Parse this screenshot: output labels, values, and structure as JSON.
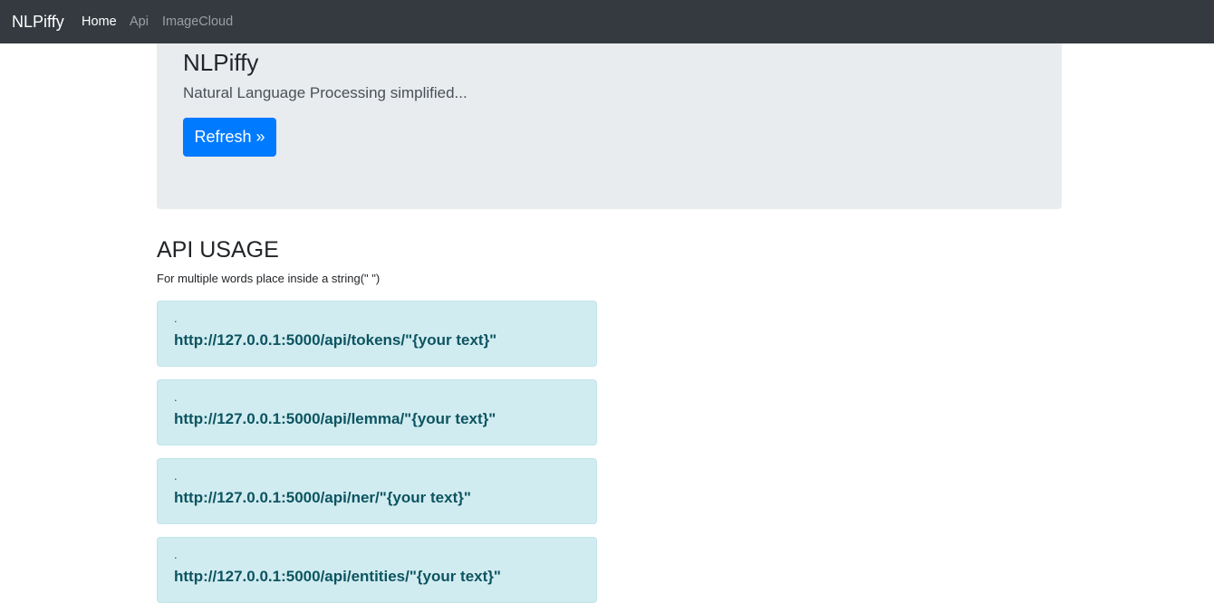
{
  "navbar": {
    "brand": "NLPiffy",
    "links": [
      {
        "label": "Home",
        "active": true
      },
      {
        "label": "Api",
        "active": false
      },
      {
        "label": "ImageCloud",
        "active": false
      }
    ]
  },
  "jumbotron": {
    "title": "NLPiffy",
    "lead": "Natural Language Processing simplified...",
    "button_label": "Refresh »"
  },
  "api_section": {
    "title": "API USAGE",
    "note": "For multiple words place inside a string(\" \")",
    "endpoints": [
      {
        "dot": ".",
        "url": "http://127.0.0.1:5000/api/tokens/\"{your text}\""
      },
      {
        "dot": ".",
        "url": "http://127.0.0.1:5000/api/lemma/\"{your text}\""
      },
      {
        "dot": ".",
        "url": "http://127.0.0.1:5000/api/ner/\"{your text}\""
      },
      {
        "dot": ".",
        "url": "http://127.0.0.1:5000/api/entities/\"{your text}\""
      }
    ]
  },
  "colors": {
    "navbar_bg": "#343a40",
    "jumbotron_bg": "#e9ecef",
    "primary": "#007bff",
    "alert_info_bg": "#d1ecf1",
    "alert_info_text": "#0c5460"
  }
}
